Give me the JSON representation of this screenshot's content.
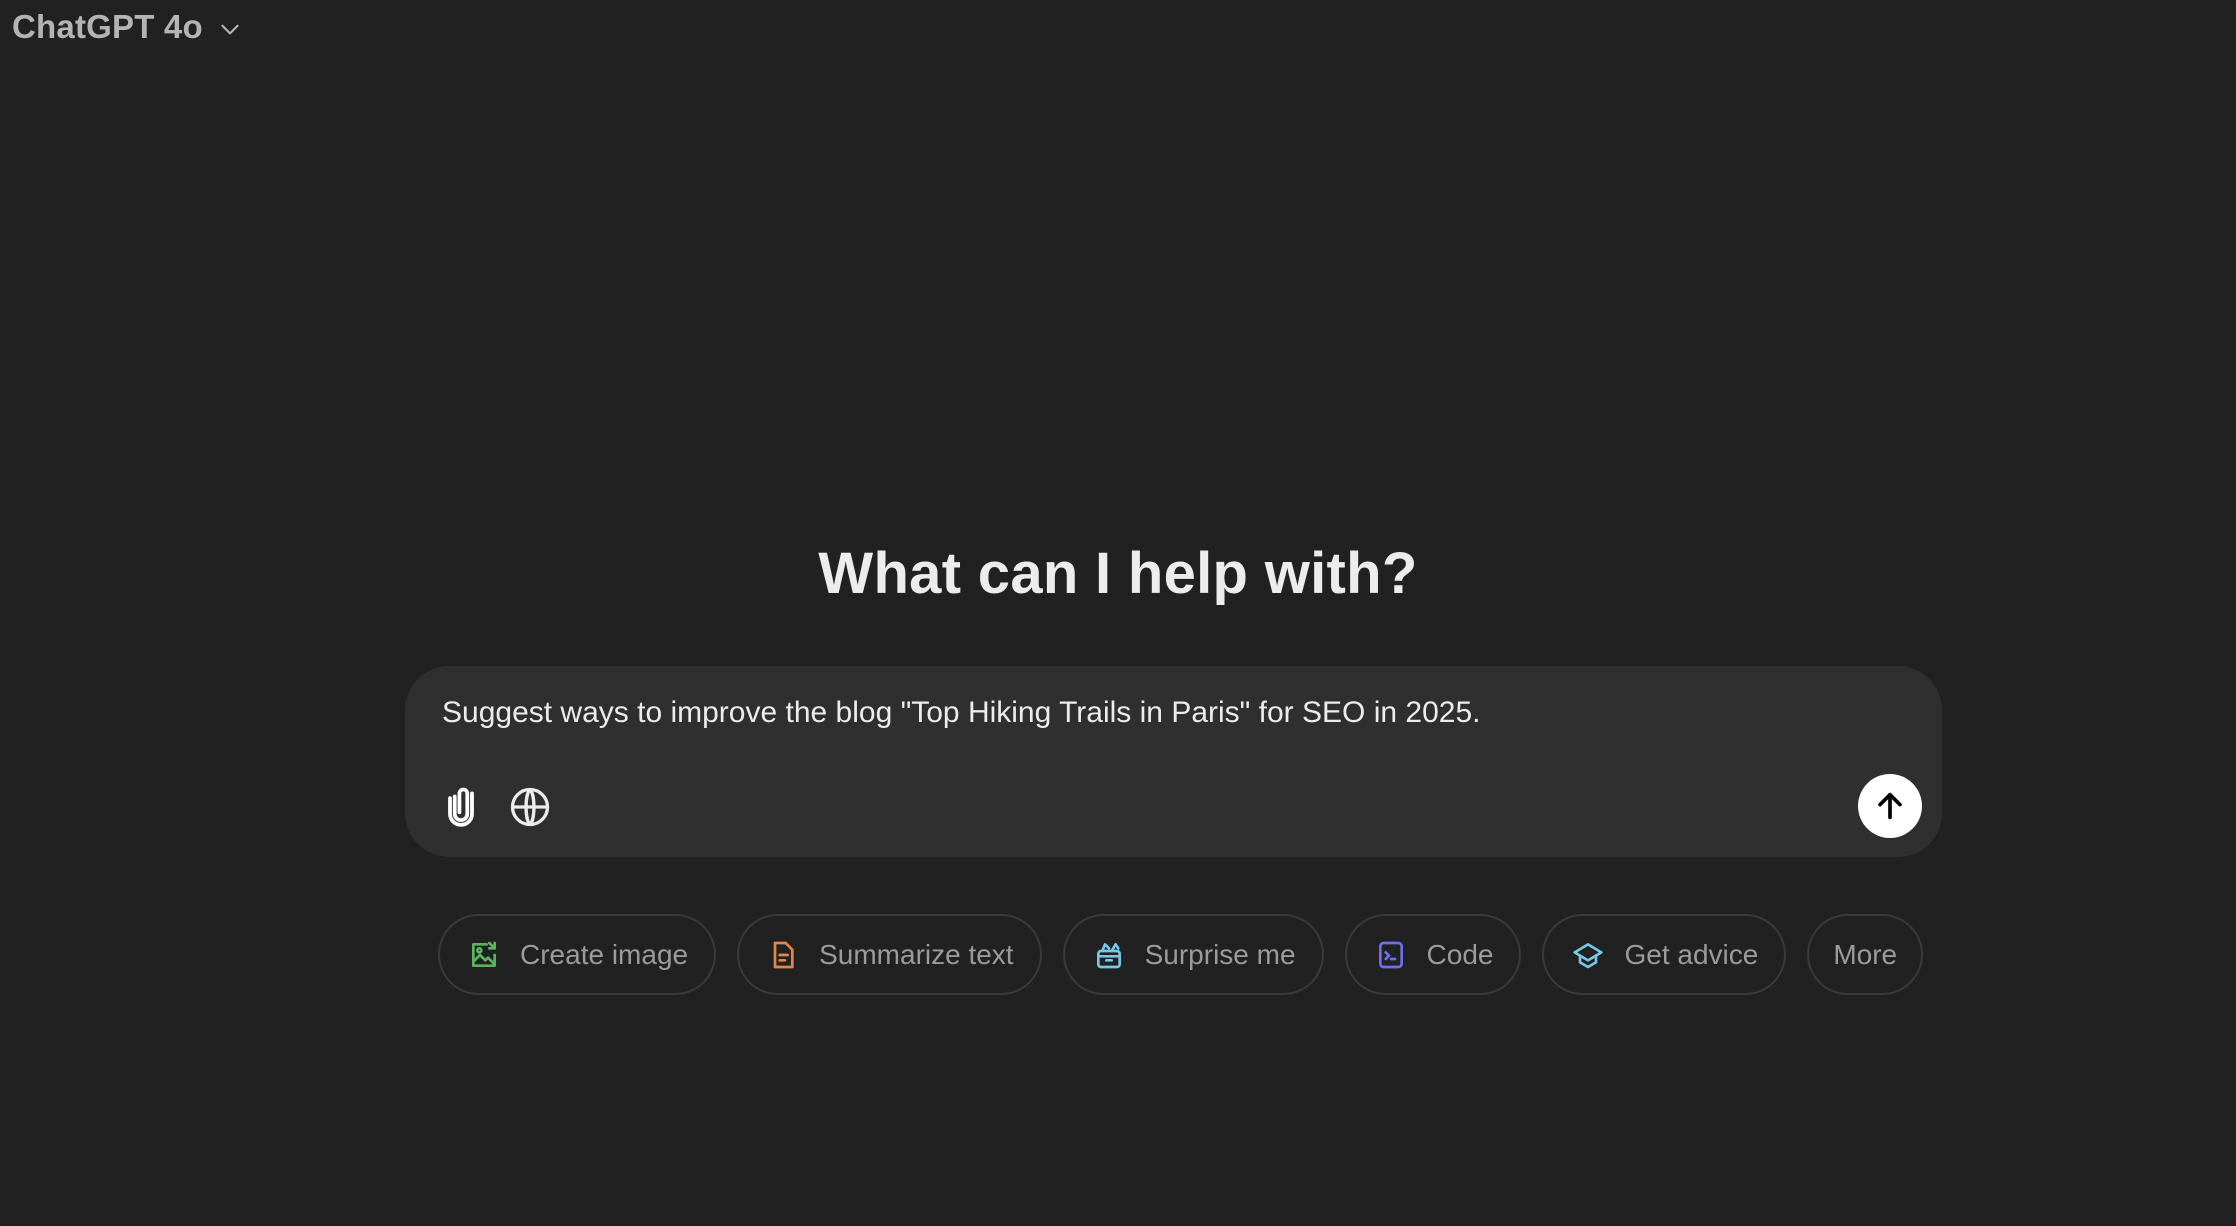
{
  "header": {
    "model_name": "ChatGPT 4o",
    "model_dropdown_icon": "chevron-down-icon"
  },
  "main": {
    "heading": "What can I help with?",
    "composer": {
      "value": "Suggest ways to improve the blog \"Top Hiking Trails in Paris\" for SEO in 2025.",
      "attach_icon": "paperclip-icon",
      "search_icon": "globe-icon",
      "send_icon": "arrow-up-icon"
    },
    "suggestions": [
      {
        "label": "Create image",
        "icon": "image-icon",
        "color": "#5ab55e"
      },
      {
        "label": "Summarize text",
        "icon": "document-icon",
        "color": "#e2874a"
      },
      {
        "label": "Surprise me",
        "icon": "gift-box-icon",
        "color": "#76c7e8"
      },
      {
        "label": "Code",
        "icon": "terminal-icon",
        "color": "#6b6ff0"
      },
      {
        "label": "Get advice",
        "icon": "graduation-cap-icon",
        "color": "#76c7e8"
      },
      {
        "label": "More",
        "icon": null,
        "color": null
      }
    ]
  }
}
